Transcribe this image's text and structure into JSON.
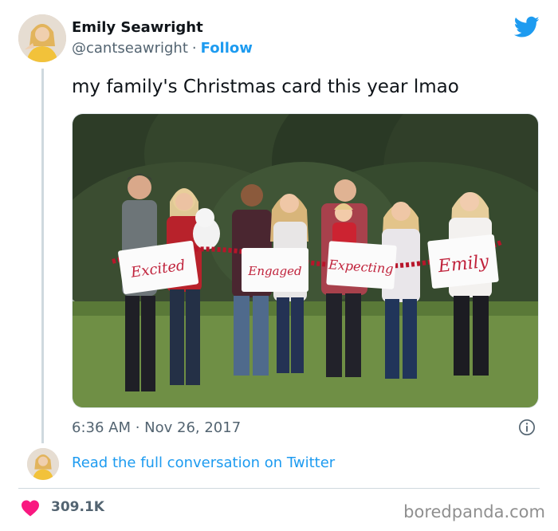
{
  "author": {
    "name": "Emily Seawright",
    "handle": "@cantseawright",
    "separator": "·",
    "follow_label": "Follow"
  },
  "tweet": {
    "text": "my family's Christmas card this year lmao",
    "timestamp": "6:36 AM · Nov 26, 2017",
    "conversation_link": "Read the full conversation on Twitter",
    "likes": "309.1K"
  },
  "photo": {
    "signs": [
      "Excited",
      "Engaged",
      "Expecting",
      "Emily"
    ]
  },
  "watermark": "boredpanda.com",
  "colors": {
    "accent": "#1d9bf0",
    "like": "#f91880",
    "secondary_text": "#536471",
    "sign_text": "#c0223b"
  },
  "icons": [
    "twitter-bird-icon",
    "info-icon",
    "heart-icon"
  ]
}
